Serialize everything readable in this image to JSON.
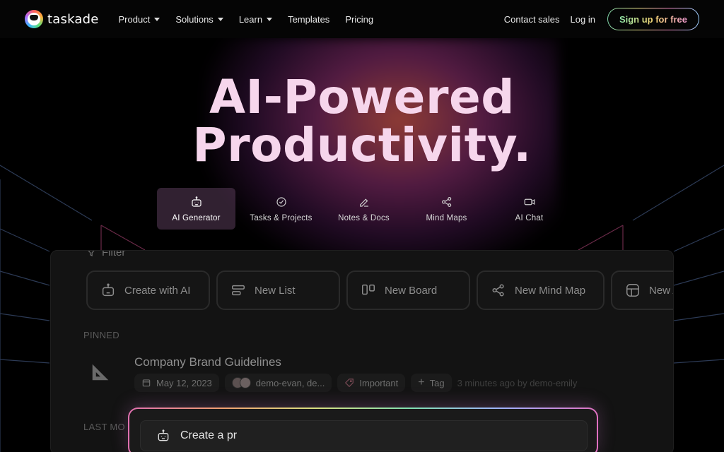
{
  "nav": {
    "brand": "taskade",
    "items": [
      {
        "label": "Product",
        "dropdown": true
      },
      {
        "label": "Solutions",
        "dropdown": true
      },
      {
        "label": "Learn",
        "dropdown": true
      },
      {
        "label": "Templates",
        "dropdown": false
      },
      {
        "label": "Pricing",
        "dropdown": false
      }
    ],
    "contact": "Contact sales",
    "login": "Log in",
    "signup": "Sign up for free"
  },
  "hero": {
    "line1": "AI-Powered",
    "line2": "Productivity."
  },
  "tabs": [
    {
      "label": "AI Generator",
      "icon": "robot-icon",
      "active": true
    },
    {
      "label": "Tasks & Projects",
      "icon": "check-circle-icon",
      "active": false
    },
    {
      "label": "Notes & Docs",
      "icon": "pencil-icon",
      "active": false
    },
    {
      "label": "Mind Maps",
      "icon": "share-nodes-icon",
      "active": false
    },
    {
      "label": "AI Chat",
      "icon": "video-icon",
      "active": false
    }
  ],
  "panel": {
    "filter": "Filter",
    "cards": [
      {
        "label": "Create with AI",
        "icon": "robot-icon"
      },
      {
        "label": "New List",
        "icon": "list-icon"
      },
      {
        "label": "New Board",
        "icon": "board-icon"
      },
      {
        "label": "New Mind Map",
        "icon": "share-nodes-icon"
      },
      {
        "label": "New A",
        "icon": "grid-icon"
      }
    ],
    "pinned_label": "PINNED",
    "doc": {
      "title": "Company Brand Guidelines",
      "date": "May 12, 2023",
      "members": "demo-evan, de...",
      "tag": "Important",
      "add_tag": "Tag",
      "updated": "3 minutes ago by demo-emily"
    },
    "last_label": "LAST MO",
    "prompt_text": "Create a pr"
  },
  "colors": {
    "background": "#000000",
    "headline": "#f6d6ec",
    "glow": "#b04c78"
  }
}
